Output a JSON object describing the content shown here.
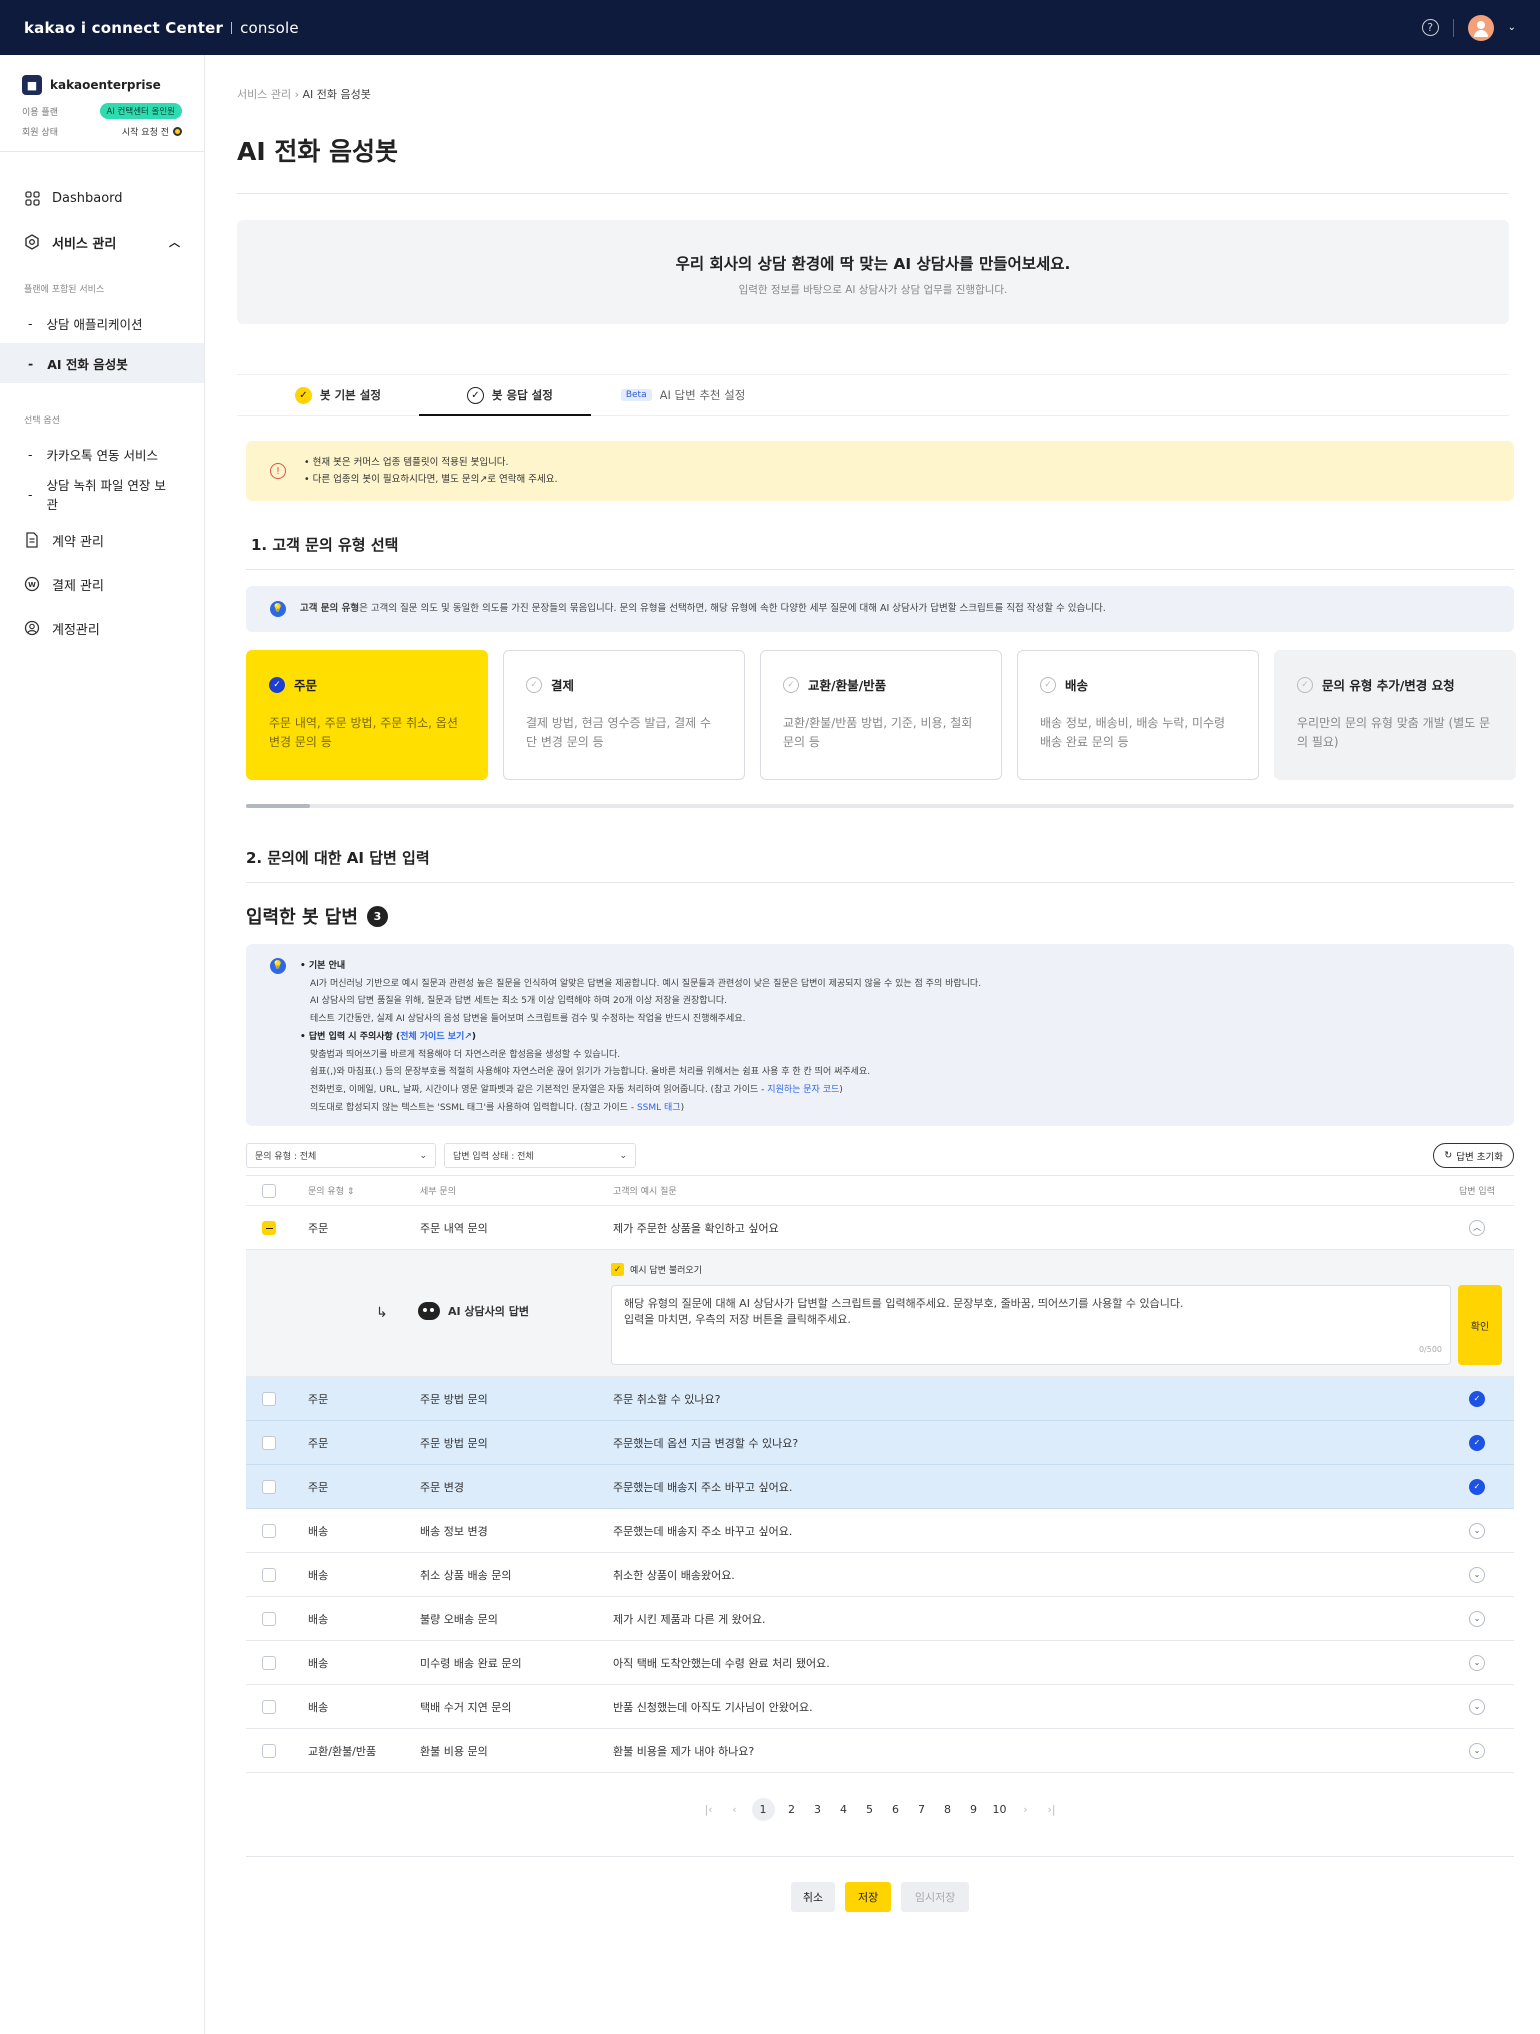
{
  "header": {
    "brand": "kakao i connect Center",
    "console": "console",
    "help_icon": "?"
  },
  "org": {
    "logo": "■",
    "name": "kakaoenterprise",
    "plan_label": "이용 플랜",
    "plan_value": "AI 컨택센터 올인원",
    "status_label": "회원 상태",
    "status_value": "시작 요청 전"
  },
  "nav": {
    "dashboard": "Dashbaord",
    "service": "서비스 관리",
    "group1": "플랜에 포함된 서비스",
    "sub1": "상담 애플리케이션",
    "sub2": "AI 전화 음성봇",
    "group2": "선택 옵션",
    "sub3": "카카오톡 연동 서비스",
    "sub4": "상담 녹취 파일 연장 보관",
    "contract": "계약 관리",
    "payment": "결제 관리",
    "account": "계정관리"
  },
  "breadcrumb": {
    "parent": "서비스 관리",
    "current": "AI 전화 음성봇"
  },
  "page_title": "AI 전화 음성봇",
  "hero": {
    "title": "우리 회사의 상담 환경에 딱 맞는 AI 상담사를 만들어보세요.",
    "subtitle": "입력한 정보를 바탕으로 AI 상담사가 상담 업무를 진행합니다."
  },
  "tabs": {
    "t1": "봇 기본 설정",
    "t2": "봇 응답 설정",
    "beta": "Beta",
    "t3": "AI 답변 추천 설정"
  },
  "alert": {
    "line1": "현재 봇은 커머스 업종 템플릿이 적용된 봇입니다.",
    "line2": "다른 업종의 봇이 필요하시다면, 별도 문의↗로 연락해 주세요."
  },
  "section1": {
    "title": "1. 고객 문의 유형 선택",
    "info_bold": "고객 문의 유형",
    "info_text": "은 고객의 질문 의도 및 동일한 의도를 가진 문장들의 묶음입니다.  문의 유형을 선택하면, 해당 유형에 속한 다양한 세부 질문에 대해 AI 상담사가 답변할 스크립트를 직접 작성할 수 있습니다."
  },
  "cards": [
    {
      "title": "주문",
      "desc": "주문 내역, 주문 방법, 주문 취소, 옵션 변경 문의 등"
    },
    {
      "title": "결제",
      "desc": "결제 방법, 현금 영수증 발급, 결제 수단 변경 문의 등"
    },
    {
      "title": "교환/환불/반품",
      "desc": "교환/환불/반품 방법, 기준, 비용, 철회 문의 등"
    },
    {
      "title": "배송",
      "desc": "배송 정보, 배송비, 배송 누락, 미수령 배송 완료 문의 등"
    },
    {
      "title": "문의 유형 추가/변경 요청",
      "desc": "우리만의 문의 유형 맞춤 개발 (별도 문의 필요)"
    }
  ],
  "section2": {
    "title": "2. 문의에 대한 AI 답변 입력",
    "bot_title": "입력한 봇 답변",
    "bot_count": "3"
  },
  "guide": {
    "h1": "기본 안내",
    "l1": "AI가 머신러닝 기반으로 예시 질문과 관련성 높은 질문을 인식하여 알맞은 답변을 제공합니다. 예시 질문들과 관련성이 낮은 질문은 답변이 제공되지 않을 수 있는 점 주의 바랍니다.",
    "l2": "AI 상담사의 답변 품질을 위해, 질문과 답변 세트는 최소 5개 이상 입력해야 하며 20개 이상 저장을 권장합니다.",
    "l3": "테스트 기간동안, 실제 AI 상담사의 음성 답변을 들어보며 스크립트를 검수 및 수정하는 작업을 반드시 진행해주세요.",
    "h2": "답변 입력 시 주의사항 (",
    "h2_link": "전체 가이드 보기↗",
    "h2_end": ")",
    "l4": "맞춤법과 띄어쓰기를 바르게 적용해야 더 자연스러운 합성음을 생성할 수 있습니다.",
    "l5": "쉼표(,)와 마침표(.) 등의 문장부호를 적절히 사용해야 자연스러운 끊어 읽기가 가능합니다. 올바른 처리를 위해서는 쉼표 사용 후 한 칸 띄어 써주세요.",
    "l6": "전화번호, 이메일, URL, 날짜, 시간이나 영문 알파벳과 같은 기본적인 문자열은 자동 처리하여 읽어줍니다. (참고 가이드 - ",
    "l6_link": "지원하는 문자 코드",
    "l6_end": ")",
    "l7": "의도대로 합성되지 않는 텍스트는 'SSML 태그'를 사용하여 입력합니다. (참고 가이드 - ",
    "l7_link": "SSML 태그",
    "l7_end": ")"
  },
  "filters": {
    "type": "문의 유형 : 전체",
    "status": "답변 입력 상태 : 전체",
    "reset": "답변 초기화"
  },
  "table": {
    "headers": {
      "type": "문의 유형",
      "detail": "세부 문의",
      "example": "고객의 예시 질문",
      "answer": "답변 입력"
    },
    "expanded": {
      "type": "주문",
      "detail": "주문 내역 문의",
      "example": "제가 주문한 상품을 확인하고 싶어요",
      "load_label": "예시 답변 불러오기",
      "bot_label": "AI 상담사의 답변",
      "placeholder1": "해당 유형의 질문에 대해 AI 상담사가 답변할 스크립트를 입력해주세요. 문장부호, 줄바꿈, 띄어쓰기를 사용할 수 있습니다.",
      "placeholder2": "입력을 마치면, 우측의 저장 버튼을 클릭해주세요.",
      "counter": "0/500",
      "confirm": "확인"
    },
    "rows": [
      {
        "type": "주문",
        "detail": "주문 방법 문의",
        "example": "주문 취소할 수 있나요?",
        "done": true
      },
      {
        "type": "주문",
        "detail": "주문 방법 문의",
        "example": "주문했는데 옵션 지금 변경할 수 있나요?",
        "done": true
      },
      {
        "type": "주문",
        "detail": "주문 변경",
        "example": "주문했는데 배송지 주소 바꾸고 싶어요.",
        "done": true
      },
      {
        "type": "배송",
        "detail": "배송 정보 변경",
        "example": "주문했는데 배송지 주소 바꾸고 싶어요.",
        "done": false
      },
      {
        "type": "배송",
        "detail": "취소 상품 배송 문의",
        "example": "취소한 상품이 배송왔어요.",
        "done": false
      },
      {
        "type": "배송",
        "detail": "불량 오배송 문의",
        "example": "제가 시킨 제품과 다른 게 왔어요.",
        "done": false
      },
      {
        "type": "배송",
        "detail": "미수령 배송 완료 문의",
        "example": "아직 택배 도착안했는데 수령 완료 처리 됐어요.",
        "done": false
      },
      {
        "type": "배송",
        "detail": "택배 수거 지연 문의",
        "example": "반품 신청했는데 아직도 기사님이 안왔어요.",
        "done": false
      },
      {
        "type": "교환/환불/반품",
        "detail": "환불 비용 문의",
        "example": "환불 비용을 제가 내야 하나요?",
        "done": false
      }
    ]
  },
  "pager": {
    "pages": [
      "1",
      "2",
      "3",
      "4",
      "5",
      "6",
      "7",
      "8",
      "9",
      "10"
    ]
  },
  "actions": {
    "cancel": "취소",
    "save": "저장",
    "temp": "임시저장"
  }
}
